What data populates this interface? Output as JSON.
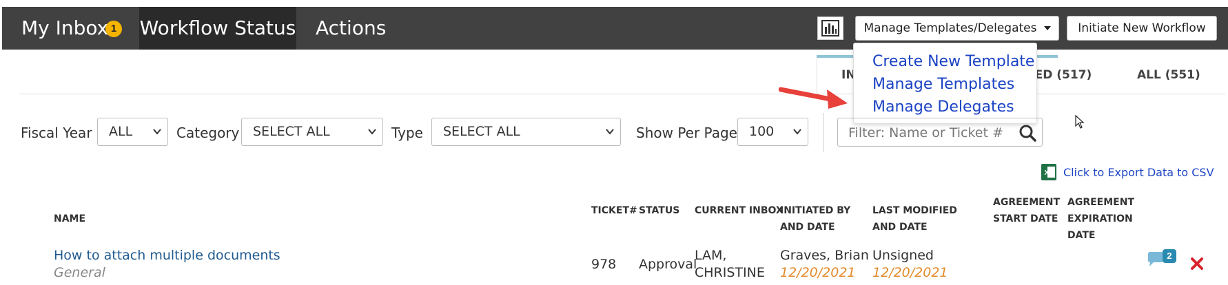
{
  "nav": {
    "inbox_label": "My Inbox",
    "inbox_badge": "1",
    "workflow_label": "Workflow Status",
    "actions_label": "Actions"
  },
  "toolbar": {
    "chart_icon": "bar-chart-icon",
    "manage_label": "Manage Templates/Delegates",
    "initiate_label": "Initiate New Workflow"
  },
  "dropdown": {
    "items": [
      {
        "label": "Create New Template"
      },
      {
        "label": "Manage Templates"
      },
      {
        "label": "Manage Delegates"
      }
    ]
  },
  "tabs": {
    "in_partial": "IN",
    "completed_partial": "TED (517)",
    "all": "ALL (551)"
  },
  "filters": {
    "fiscal_year_label": "Fiscal Year",
    "fiscal_year_value": "ALL",
    "category_label": "Category",
    "category_value": "SELECT ALL",
    "type_label": "Type",
    "type_value": "SELECT ALL",
    "per_page_label": "Show Per Page",
    "per_page_value": "100",
    "search_placeholder": "Filter: Name or Ticket #"
  },
  "export": {
    "label": "Click to Export Data to CSV",
    "icon": "excel-icon"
  },
  "table": {
    "columns": {
      "name": "NAME",
      "ticket": "TICKET#",
      "status": "STATUS",
      "inbox": "CURRENT INBOX",
      "initiated": [
        "INITIATED BY",
        "AND DATE"
      ],
      "modified": [
        "LAST MODIFIED",
        "AND DATE"
      ],
      "agreement_start": [
        "AGREEMENT",
        "START DATE"
      ],
      "agreement_exp": [
        "AGREEMENT",
        "EXPIRATION",
        "DATE"
      ]
    },
    "rows": [
      {
        "name": "How to attach multiple documents",
        "category": "General",
        "ticket": "978",
        "status": "Approval",
        "inbox": [
          "LAM,",
          "CHRISTINE"
        ],
        "initiated_by": "Graves, Brian",
        "initiated_date": "12/20/2021",
        "modified_by": "Unsigned",
        "modified_date": "12/20/2021",
        "comment_count": "2"
      }
    ]
  },
  "colors": {
    "topbar": "#414141",
    "link": "#1c43c4",
    "date": "#e48a2a",
    "badge": "#f5b400"
  }
}
